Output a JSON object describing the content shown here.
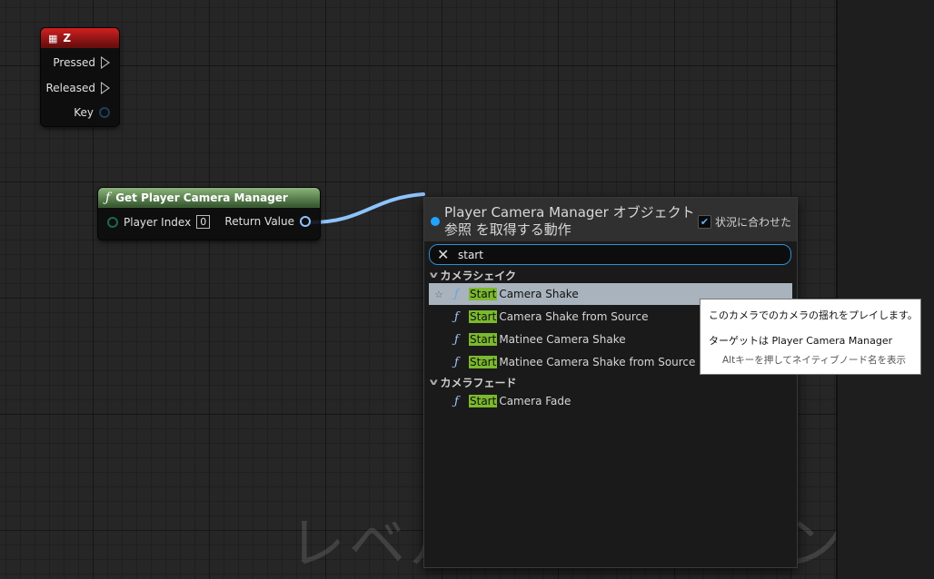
{
  "graph": {
    "watermark": "レベル ブループリント"
  },
  "node_z": {
    "title": "Z",
    "pins": [
      "Pressed",
      "Released",
      "Key"
    ]
  },
  "node_get_camera_manager": {
    "title": "Get Player Camera Manager",
    "input_label": "Player Index",
    "input_value": "0",
    "output_label": "Return Value"
  },
  "action_menu": {
    "title": "Player Camera Manager オブジェクト参照 を取得する動作",
    "context_sensitive_label": "状況に合わせた",
    "context_sensitive_checked": true,
    "search": {
      "value": "start"
    },
    "categories": [
      {
        "name": "カメラシェイク",
        "items": [
          {
            "highlight": "Start",
            "rest": "Camera Shake",
            "selected": true
          },
          {
            "highlight": "Start",
            "rest": "Camera Shake from Source",
            "selected": false
          },
          {
            "highlight": "Start",
            "rest": "Matinee Camera Shake",
            "selected": false
          },
          {
            "highlight": "Start",
            "rest": "Matinee Camera Shake from Source",
            "selected": false
          }
        ]
      },
      {
        "name": "カメラフェード",
        "items": [
          {
            "highlight": "Start",
            "rest": "Camera Fade",
            "selected": false
          }
        ]
      }
    ]
  },
  "tooltip": {
    "line1": "このカメラでのカメラの揺れをプレイします。",
    "line2": "ターゲットは Player Camera Manager",
    "line3": "Altキーを押してネイティブノード名を表示"
  },
  "colors": {
    "accent": "#2d8fd5",
    "highlight": "#7bb92e",
    "event_node": "#b01818",
    "function_node": "#7aa56b",
    "wire": "#8ec3ff"
  }
}
